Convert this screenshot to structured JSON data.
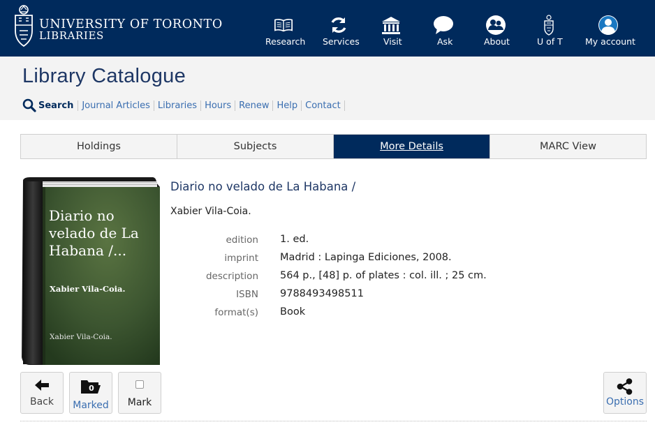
{
  "header": {
    "logo_line1": "UNIVERSITY OF TORONTO",
    "logo_line2": "LIBRARIES",
    "nav": [
      {
        "label": "Research",
        "icon": "book-icon"
      },
      {
        "label": "Services",
        "icon": "refresh-icon"
      },
      {
        "label": "Visit",
        "icon": "building-icon"
      },
      {
        "label": "Ask",
        "icon": "speech-bubble-icon"
      },
      {
        "label": "About",
        "icon": "people-icon"
      },
      {
        "label": "U of T",
        "icon": "crest-icon"
      },
      {
        "label": "My account",
        "icon": "user-icon"
      }
    ]
  },
  "subheader": {
    "title": "Library Catalogue",
    "search_label": "Search",
    "links": [
      "Journal Articles",
      "Libraries",
      "Hours",
      "Renew",
      "Help",
      "Contact"
    ]
  },
  "tabs": [
    {
      "label": "Holdings",
      "active": false
    },
    {
      "label": "Subjects",
      "active": false
    },
    {
      "label": "More Details",
      "active": true
    },
    {
      "label": "MARC View",
      "active": false
    }
  ],
  "cover": {
    "title": "Diario no velado de La Habana /...",
    "author": "Xabier Vila-Coia.",
    "author_footer": "Xabier Vila-Coia."
  },
  "record": {
    "title": "Diario no velado de La Habana /",
    "author": "Xabier Vila-Coia.",
    "fields": [
      {
        "label": "edition",
        "value": "1. ed."
      },
      {
        "label": "imprint",
        "value": "Madrid : Lapinga Ediciones, 2008."
      },
      {
        "label": "description",
        "value": "564 p., [48] p. of plates : col. ill. ; 25 cm."
      },
      {
        "label": "ISBN",
        "value": "9788493498511"
      },
      {
        "label": "format(s)",
        "value": "Book"
      }
    ]
  },
  "tools": {
    "back_label": "Back",
    "marked_label": "Marked",
    "marked_count": "0",
    "mark_label": "Mark",
    "options_label": "Options"
  },
  "colors": {
    "navy": "#002a5c",
    "link": "#3a6eb0",
    "cover_green": "#3f5a30"
  }
}
